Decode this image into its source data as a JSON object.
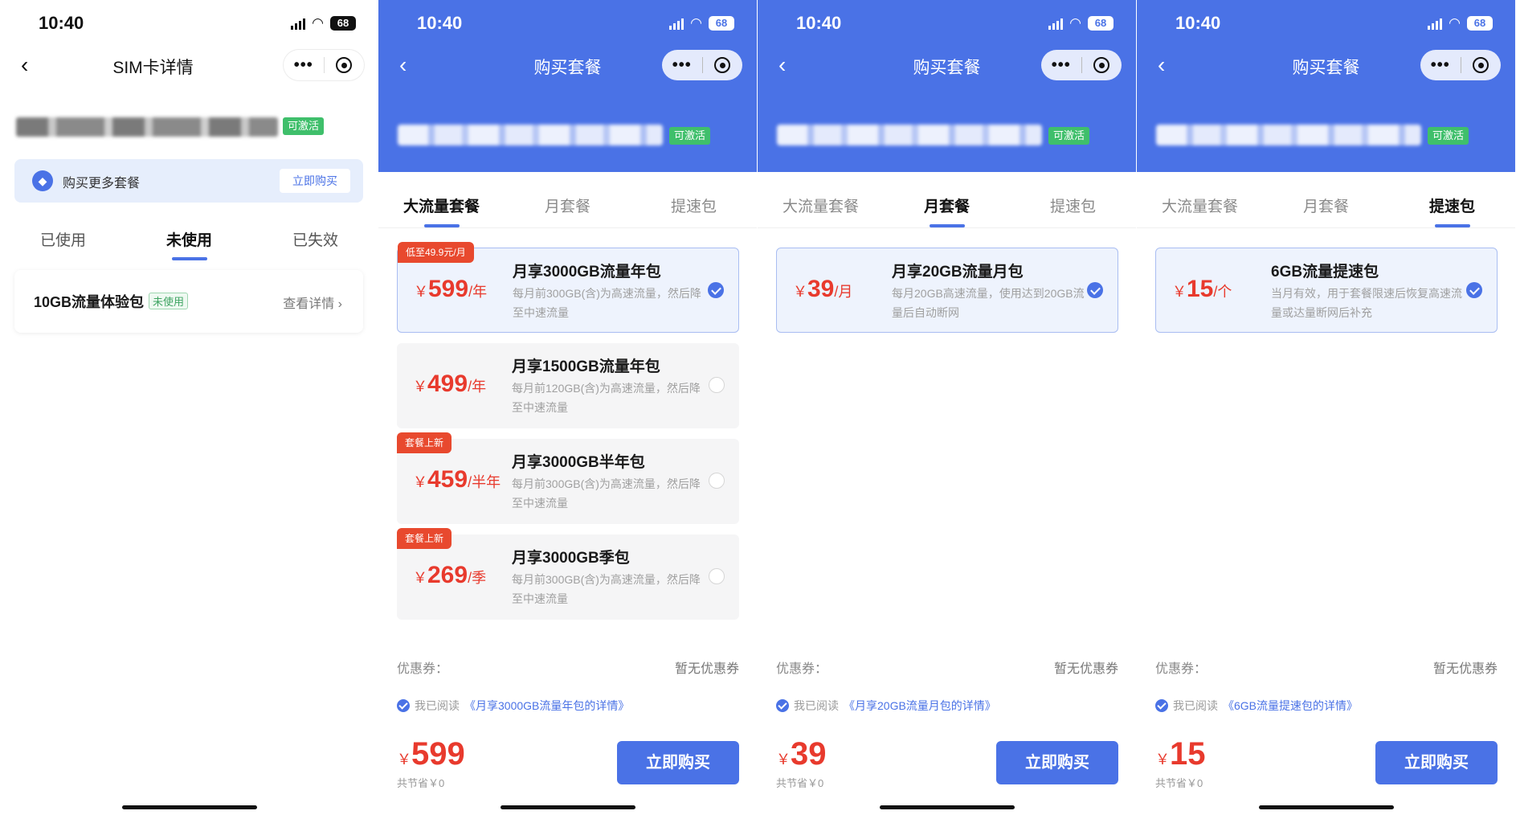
{
  "status": {
    "time": "10:40",
    "battery": "68"
  },
  "screen1": {
    "title": "SIM卡详情",
    "activation_badge": "可激活",
    "promo_text": "购买更多套餐",
    "promo_button": "立即购买",
    "tabs": [
      "已使用",
      "未使用",
      "已失效"
    ],
    "package": {
      "name": "10GB流量体验包",
      "status": "未使用",
      "detail": "查看详情 ›"
    }
  },
  "shared": {
    "title": "购买套餐",
    "activation_badge": "可激活",
    "tabs": [
      "大流量套餐",
      "月套餐",
      "提速包"
    ],
    "coupon_label": "优惠券：",
    "coupon_value": "暂无优惠券",
    "agree_prefix": "我已阅读",
    "saved": "共节省￥0",
    "buy_button": "立即购买",
    "currency": "￥"
  },
  "screen2": {
    "plans": [
      {
        "ribbon": "低至49.9元/月",
        "price": "599",
        "unit": "/年",
        "name": "月享3000GB流量年包",
        "desc": "每月前300GB(含)为高速流量，然后降至中速流量"
      },
      {
        "ribbon": "",
        "price": "499",
        "unit": "/年",
        "name": "月享1500GB流量年包",
        "desc": "每月前120GB(含)为高速流量，然后降至中速流量"
      },
      {
        "ribbon": "套餐上新",
        "price": "459",
        "unit": "/半年",
        "name": "月享3000GB半年包",
        "desc": "每月前300GB(含)为高速流量，然后降至中速流量"
      },
      {
        "ribbon": "套餐上新",
        "price": "269",
        "unit": "/季",
        "name": "月享3000GB季包",
        "desc": "每月前300GB(含)为高速流量，然后降至中速流量"
      }
    ],
    "agree_link": "《月享3000GB流量年包的详情》",
    "total": "599"
  },
  "screen3": {
    "plan": {
      "price": "39",
      "unit": "/月",
      "name": "月享20GB流量月包",
      "desc": "每月20GB高速流量，使用达到20GB流量后自动断网"
    },
    "agree_link": "《月享20GB流量月包的详情》",
    "total": "39"
  },
  "screen4": {
    "plan": {
      "price": "15",
      "unit": "/个",
      "name": "6GB流量提速包",
      "desc": "当月有效，用于套餐限速后恢复高速流量或达量断网后补充"
    },
    "agree_link": "《6GB流量提速包的详情》",
    "total": "15"
  }
}
